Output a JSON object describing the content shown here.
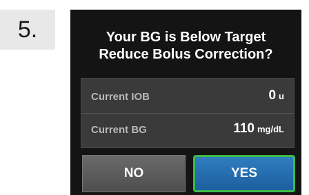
{
  "step": {
    "number": "5."
  },
  "dialog": {
    "title_line1": "Your BG is Below Target",
    "title_line2": "Reduce Bolus Correction?"
  },
  "info": {
    "rows": [
      {
        "label": "Current IOB",
        "value": "0",
        "unit": "u"
      },
      {
        "label": "Current BG",
        "value": "110",
        "unit": "mg/dL"
      }
    ]
  },
  "buttons": {
    "no_label": "NO",
    "yes_label": "YES"
  },
  "colors": {
    "screen_bg": "#141414",
    "panel_bg": "#3a3a3a",
    "yes_button": "#2770b0",
    "yes_border": "#3dbb4a",
    "no_button": "#5c5c5c"
  }
}
